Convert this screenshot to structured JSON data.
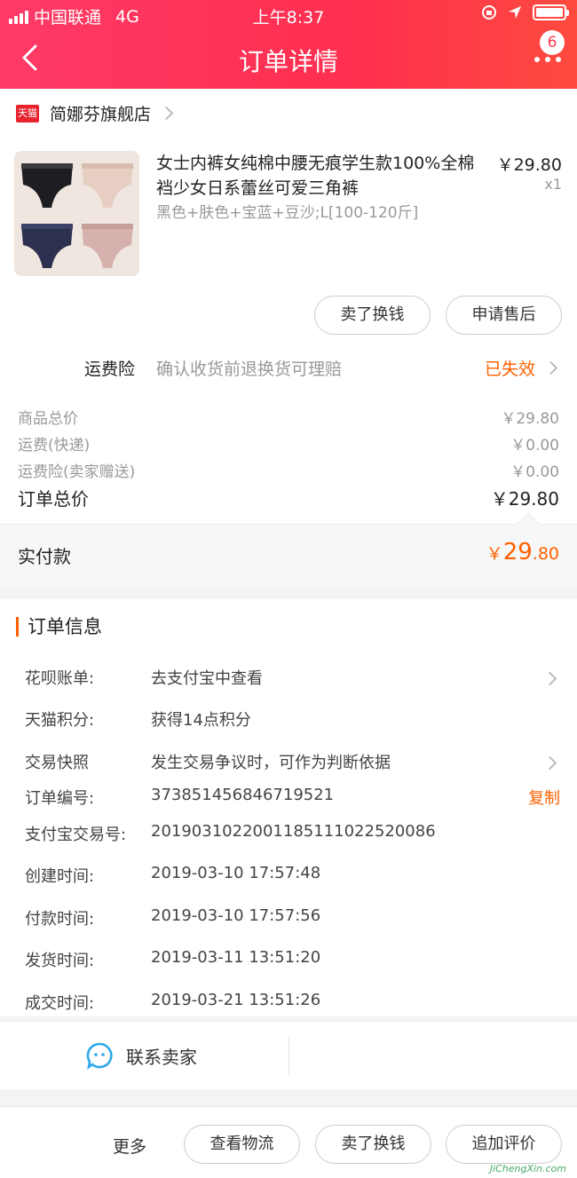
{
  "status_bar": {
    "carrier": "中国联通",
    "network": "4G",
    "time": "上午8:37"
  },
  "header": {
    "title": "订单详情",
    "badge_count": "6",
    "accent_color": "#ff3a4a"
  },
  "store": {
    "logo_text": "天猫",
    "name": "简娜芬旗舰店"
  },
  "product": {
    "name": "女士内裤女纯棉中腰无痕学生款100%全棉裆少女日系蕾丝可爱三角裤",
    "sku": "黑色+肤色+宝蓝+豆沙;L[100-120斤]",
    "price": "￥29.80",
    "quantity": "x1"
  },
  "item_actions": {
    "sell_label": "卖了换钱",
    "after_sale_label": "申请售后"
  },
  "insurance": {
    "label": "运费险",
    "description": "确认收货前退换货可理赔",
    "status": "已失效"
  },
  "costs": [
    {
      "label": "商品总价",
      "value": "￥29.80"
    },
    {
      "label": "运费(快递)",
      "value": "￥0.00"
    },
    {
      "label": "运费险(卖家赠送)",
      "value": "￥0.00"
    }
  ],
  "order_total": {
    "label": "订单总价",
    "value": "￥29.80"
  },
  "paid": {
    "label": "实付款",
    "currency": "￥",
    "integer": "29",
    "decimal": ".80"
  },
  "order_info": {
    "title": "订单信息",
    "rows": [
      {
        "key": "花呗账单:",
        "value": "去支付宝中查看"
      },
      {
        "key": "天猫积分:",
        "value": "获得14点积分"
      },
      {
        "key": "交易快照",
        "value": "发生交易争议时，可作为判断依据"
      },
      {
        "key": "订单编号:",
        "value": "373851456846719521",
        "action": "复制"
      },
      {
        "key": "支付宝交易号:",
        "value": "20190310220011851110225200​86"
      },
      {
        "key": "创建时间:",
        "value": "2019-03-10 17:57:48"
      },
      {
        "key": "付款时间:",
        "value": "2019-03-10 17:57:56"
      },
      {
        "key": "发货时间:",
        "value": "2019-03-11 13:51:20"
      },
      {
        "key": "成交时间:",
        "value": "2019-03-21 13:51:26"
      }
    ]
  },
  "contact": {
    "label": "联系卖家"
  },
  "bottom_bar": {
    "more": "更多",
    "logistics": "查看物流",
    "sell": "卖了换钱",
    "review": "追加评价"
  },
  "watermark": {
    "url": "JiChengXin.com"
  }
}
